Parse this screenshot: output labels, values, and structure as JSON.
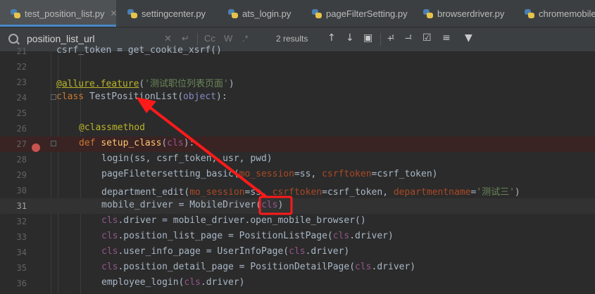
{
  "tabs": [
    {
      "label": "test_position_list.py",
      "active": true
    },
    {
      "label": "settingcenter.py",
      "active": false
    },
    {
      "label": "ats_login.py",
      "active": false
    },
    {
      "label": "pageFilterSetting.py",
      "active": false
    },
    {
      "label": "browserdriver.py",
      "active": false
    },
    {
      "label": "chromemobile.py",
      "active": false
    }
  ],
  "find": {
    "query": "position_list_url",
    "results": "2 results",
    "opt_cc": "Cc",
    "opt_w": "W",
    "opt_regex": ".*"
  },
  "editor": {
    "current_line": 31,
    "breakpoint_line": 27,
    "lines": [
      {
        "num": "21",
        "text": "csrf_token = get_cookie_xsrf()"
      },
      {
        "num": "22",
        "text": ""
      },
      {
        "num": "23",
        "text": "@allure.feature('测试职位列表页面')"
      },
      {
        "num": "24",
        "text": "class TestPositionList(object):"
      },
      {
        "num": "25",
        "text": ""
      },
      {
        "num": "26",
        "text": "@classmethod"
      },
      {
        "num": "27",
        "text": "def setup_class(cls):"
      },
      {
        "num": "28",
        "text": "login(ss, csrf_token, usr, pwd)"
      },
      {
        "num": "29",
        "text": "pageFiletersetting_basic(mo_session=ss, csrftoken=csrf_token)"
      },
      {
        "num": "30",
        "text": "department_edit(mo_session=ss, csrftoken=csrf_token, departmentname='测试三')"
      },
      {
        "num": "31",
        "text": "mobile_driver = MobileDriver(cls)"
      },
      {
        "num": "32",
        "text": "cls.driver = mobile_driver.open_mobile_browser()"
      },
      {
        "num": "33",
        "text": "cls.position_list_page = PositionListPage(cls.driver)"
      },
      {
        "num": "34",
        "text": "cls.user_info_page = UserInfoPage(cls.driver)"
      },
      {
        "num": "35",
        "text": "cls.position_detail_page = PositionDetailPage(cls.driver)"
      },
      {
        "num": "36",
        "text": "employee_login(cls.driver)"
      }
    ]
  },
  "colors": {
    "annotation_red": "#ff1a1a",
    "keyword": "#cc7832",
    "function_name": "#ffc66d",
    "decorator": "#bbb529",
    "string": "#6a8759",
    "self_param": "#94558d",
    "named_arg": "#aa4926",
    "builtin": "#8888c6"
  }
}
